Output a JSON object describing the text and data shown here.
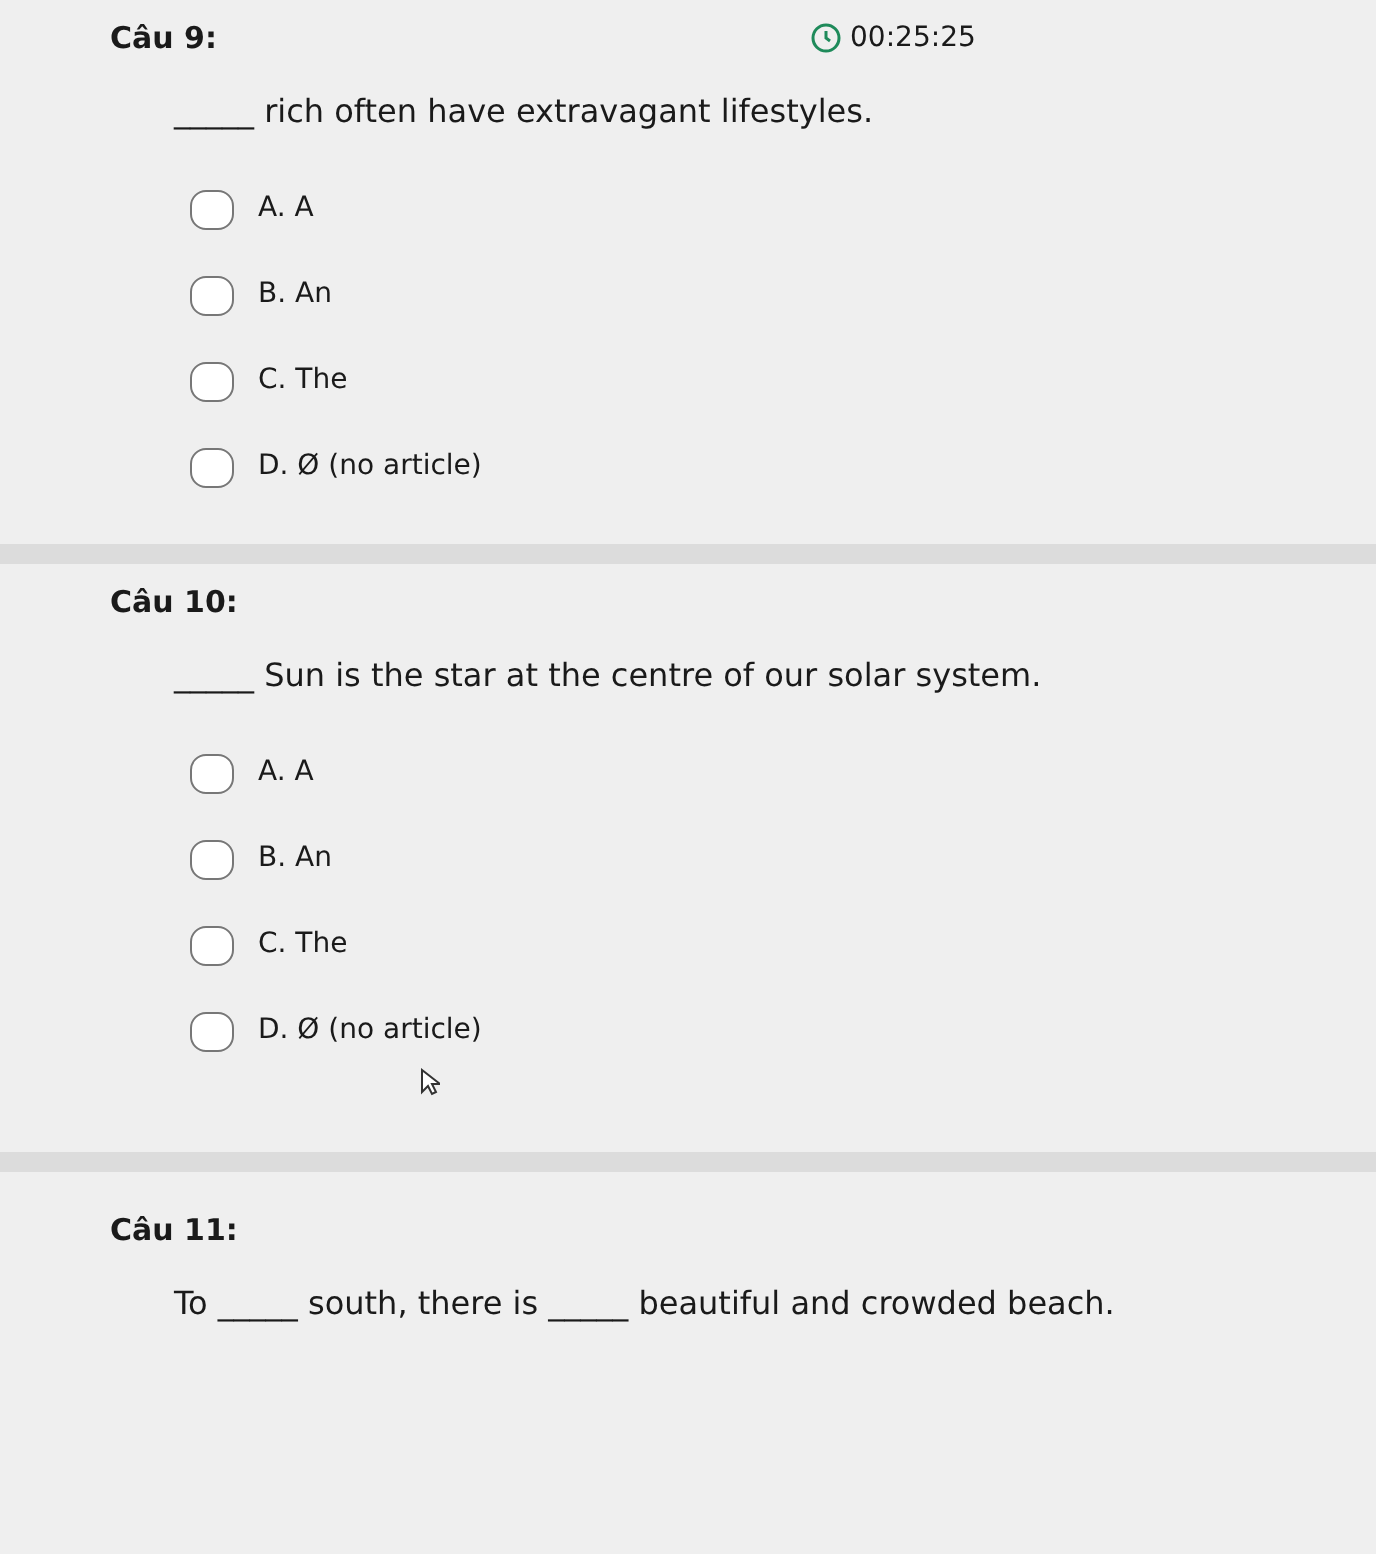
{
  "questions": [
    {
      "title": "Câu 9:",
      "timer": "00:25:25",
      "text": "_____ rich often have extravagant lifestyles.",
      "options": [
        {
          "label": "A. A",
          "selected": false
        },
        {
          "label": "B. An",
          "selected": false
        },
        {
          "label": "C. The",
          "selected": false
        },
        {
          "label": "D. Ø (no article)",
          "selected": false
        }
      ]
    },
    {
      "title": "Câu 10:",
      "text": "_____ Sun is the star at the centre of our solar system.",
      "cursor": true,
      "options": [
        {
          "label": "A. A",
          "selected": false
        },
        {
          "label": "B. An",
          "selected": false
        },
        {
          "label": "C. The",
          "selected": false
        },
        {
          "label": "D. Ø (no article)",
          "selected": false
        }
      ]
    },
    {
      "title": "Câu 11:",
      "text": "To _____ south, there is _____ beautiful and crowded beach."
    }
  ]
}
